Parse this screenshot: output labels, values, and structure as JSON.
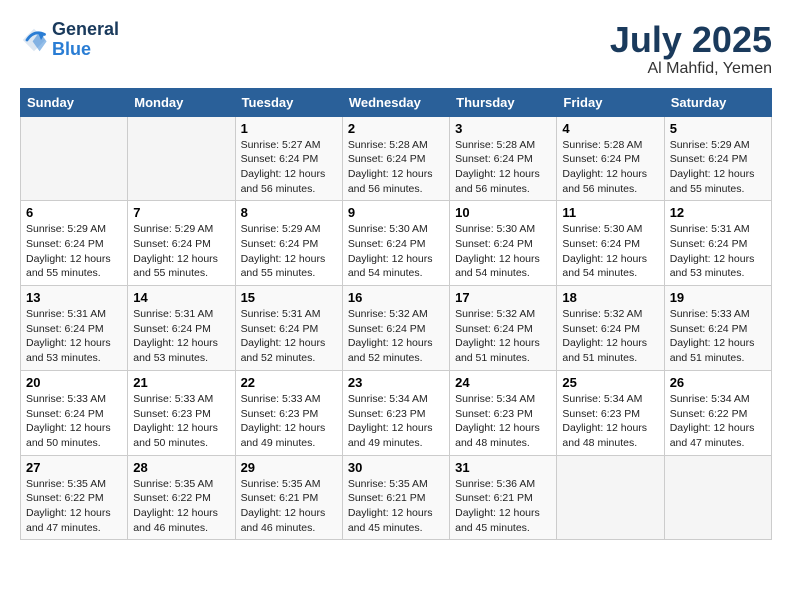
{
  "logo": {
    "line1": "General",
    "line2": "Blue"
  },
  "title": "July 2025",
  "location": "Al Mahfid, Yemen",
  "days_of_week": [
    "Sunday",
    "Monday",
    "Tuesday",
    "Wednesday",
    "Thursday",
    "Friday",
    "Saturday"
  ],
  "weeks": [
    [
      {
        "day": "",
        "info": ""
      },
      {
        "day": "",
        "info": ""
      },
      {
        "day": "1",
        "info": "Sunrise: 5:27 AM\nSunset: 6:24 PM\nDaylight: 12 hours and 56 minutes."
      },
      {
        "day": "2",
        "info": "Sunrise: 5:28 AM\nSunset: 6:24 PM\nDaylight: 12 hours and 56 minutes."
      },
      {
        "day": "3",
        "info": "Sunrise: 5:28 AM\nSunset: 6:24 PM\nDaylight: 12 hours and 56 minutes."
      },
      {
        "day": "4",
        "info": "Sunrise: 5:28 AM\nSunset: 6:24 PM\nDaylight: 12 hours and 56 minutes."
      },
      {
        "day": "5",
        "info": "Sunrise: 5:29 AM\nSunset: 6:24 PM\nDaylight: 12 hours and 55 minutes."
      }
    ],
    [
      {
        "day": "6",
        "info": "Sunrise: 5:29 AM\nSunset: 6:24 PM\nDaylight: 12 hours and 55 minutes."
      },
      {
        "day": "7",
        "info": "Sunrise: 5:29 AM\nSunset: 6:24 PM\nDaylight: 12 hours and 55 minutes."
      },
      {
        "day": "8",
        "info": "Sunrise: 5:29 AM\nSunset: 6:24 PM\nDaylight: 12 hours and 55 minutes."
      },
      {
        "day": "9",
        "info": "Sunrise: 5:30 AM\nSunset: 6:24 PM\nDaylight: 12 hours and 54 minutes."
      },
      {
        "day": "10",
        "info": "Sunrise: 5:30 AM\nSunset: 6:24 PM\nDaylight: 12 hours and 54 minutes."
      },
      {
        "day": "11",
        "info": "Sunrise: 5:30 AM\nSunset: 6:24 PM\nDaylight: 12 hours and 54 minutes."
      },
      {
        "day": "12",
        "info": "Sunrise: 5:31 AM\nSunset: 6:24 PM\nDaylight: 12 hours and 53 minutes."
      }
    ],
    [
      {
        "day": "13",
        "info": "Sunrise: 5:31 AM\nSunset: 6:24 PM\nDaylight: 12 hours and 53 minutes."
      },
      {
        "day": "14",
        "info": "Sunrise: 5:31 AM\nSunset: 6:24 PM\nDaylight: 12 hours and 53 minutes."
      },
      {
        "day": "15",
        "info": "Sunrise: 5:31 AM\nSunset: 6:24 PM\nDaylight: 12 hours and 52 minutes."
      },
      {
        "day": "16",
        "info": "Sunrise: 5:32 AM\nSunset: 6:24 PM\nDaylight: 12 hours and 52 minutes."
      },
      {
        "day": "17",
        "info": "Sunrise: 5:32 AM\nSunset: 6:24 PM\nDaylight: 12 hours and 51 minutes."
      },
      {
        "day": "18",
        "info": "Sunrise: 5:32 AM\nSunset: 6:24 PM\nDaylight: 12 hours and 51 minutes."
      },
      {
        "day": "19",
        "info": "Sunrise: 5:33 AM\nSunset: 6:24 PM\nDaylight: 12 hours and 51 minutes."
      }
    ],
    [
      {
        "day": "20",
        "info": "Sunrise: 5:33 AM\nSunset: 6:24 PM\nDaylight: 12 hours and 50 minutes."
      },
      {
        "day": "21",
        "info": "Sunrise: 5:33 AM\nSunset: 6:23 PM\nDaylight: 12 hours and 50 minutes."
      },
      {
        "day": "22",
        "info": "Sunrise: 5:33 AM\nSunset: 6:23 PM\nDaylight: 12 hours and 49 minutes."
      },
      {
        "day": "23",
        "info": "Sunrise: 5:34 AM\nSunset: 6:23 PM\nDaylight: 12 hours and 49 minutes."
      },
      {
        "day": "24",
        "info": "Sunrise: 5:34 AM\nSunset: 6:23 PM\nDaylight: 12 hours and 48 minutes."
      },
      {
        "day": "25",
        "info": "Sunrise: 5:34 AM\nSunset: 6:23 PM\nDaylight: 12 hours and 48 minutes."
      },
      {
        "day": "26",
        "info": "Sunrise: 5:34 AM\nSunset: 6:22 PM\nDaylight: 12 hours and 47 minutes."
      }
    ],
    [
      {
        "day": "27",
        "info": "Sunrise: 5:35 AM\nSunset: 6:22 PM\nDaylight: 12 hours and 47 minutes."
      },
      {
        "day": "28",
        "info": "Sunrise: 5:35 AM\nSunset: 6:22 PM\nDaylight: 12 hours and 46 minutes."
      },
      {
        "day": "29",
        "info": "Sunrise: 5:35 AM\nSunset: 6:21 PM\nDaylight: 12 hours and 46 minutes."
      },
      {
        "day": "30",
        "info": "Sunrise: 5:35 AM\nSunset: 6:21 PM\nDaylight: 12 hours and 45 minutes."
      },
      {
        "day": "31",
        "info": "Sunrise: 5:36 AM\nSunset: 6:21 PM\nDaylight: 12 hours and 45 minutes."
      },
      {
        "day": "",
        "info": ""
      },
      {
        "day": "",
        "info": ""
      }
    ]
  ]
}
